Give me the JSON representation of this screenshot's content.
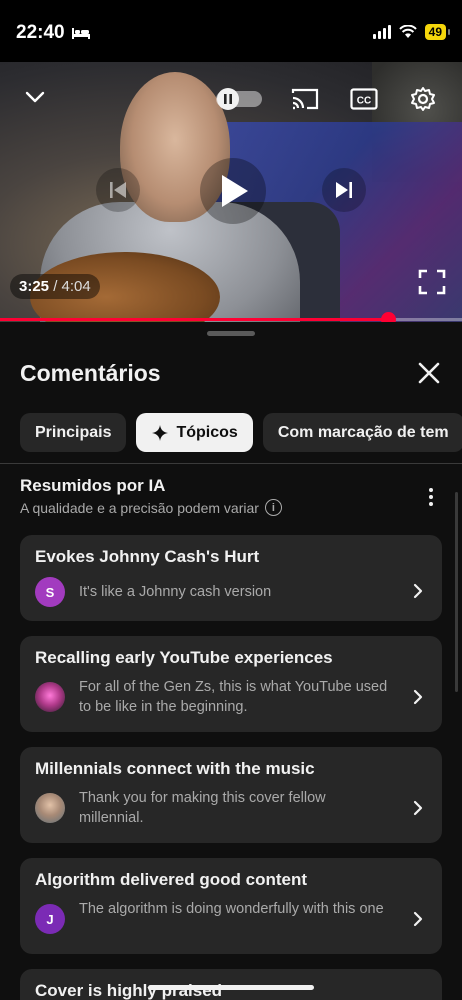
{
  "status_bar": {
    "time": "22:40",
    "battery": "49"
  },
  "player": {
    "current_time": "3:25",
    "separator": "/",
    "total_time": "4:04",
    "progress_fraction": 0.84,
    "colors": {
      "progress": "#ff0033"
    }
  },
  "comments": {
    "title": "Comentários",
    "chips": [
      {
        "label": "Principais",
        "active": false
      },
      {
        "label": "Tópicos",
        "active": true,
        "icon": "sparkle-icon"
      },
      {
        "label": "Com marcação de tem",
        "active": false
      }
    ],
    "ai_summary": {
      "title": "Resumidos por IA",
      "subtitle": "A qualidade e a precisão podem variar",
      "info_icon": "i"
    },
    "topics": [
      {
        "title": "Evokes Johnny Cash's Hurt",
        "avatar_letter": "S",
        "avatar_color": "#a23bbf",
        "text": "It's like a Johnny cash version"
      },
      {
        "title": "Recalling early YouTube experiences",
        "avatar_letter": "",
        "avatar_color": "#c23a9a",
        "text": "For all of the Gen Zs, this is what YouTube used to be like in the beginning."
      },
      {
        "title": "Millennials connect with the music",
        "avatar_letter": "",
        "avatar_color": "#7a8a92",
        "text": "Thank you for making this cover fellow millennial."
      },
      {
        "title": "Algorithm delivered good content",
        "avatar_letter": "J",
        "avatar_color": "#7b2bb5",
        "text": "The algorithm is doing wonderfully with this one"
      },
      {
        "title": "Cover is highly praised",
        "avatar_letter": "",
        "avatar_color": "#555555",
        "text": ""
      }
    ]
  }
}
